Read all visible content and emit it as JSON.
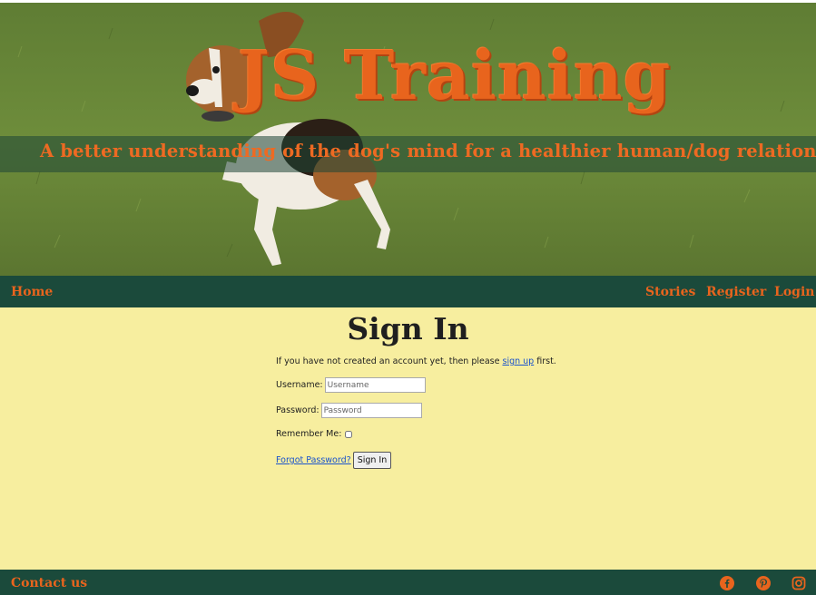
{
  "hero": {
    "title": "JS Training",
    "tagline": "A better understanding of the dog's mind for a healthier human/dog relationship"
  },
  "nav": {
    "home": "Home",
    "stories": "Stories",
    "register": "Register",
    "login": "Login"
  },
  "main": {
    "title": "Sign In",
    "intro_before": "If you have not created an account yet, then please ",
    "intro_link": "sign up",
    "intro_after": " first.",
    "username_label": "Username:",
    "username_placeholder": "Username",
    "password_label": "Password:",
    "password_placeholder": "Password",
    "remember_label": "Remember Me:",
    "forgot_link": "Forgot Password?",
    "signin_button": "Sign In"
  },
  "footer": {
    "contact": "Contact us",
    "icons": [
      "facebook-icon",
      "pinterest-icon",
      "instagram-icon"
    ]
  },
  "colors": {
    "accent": "#e8641d",
    "nav_bg": "#1b4a3b",
    "page_bg": "#f7ee9f"
  }
}
